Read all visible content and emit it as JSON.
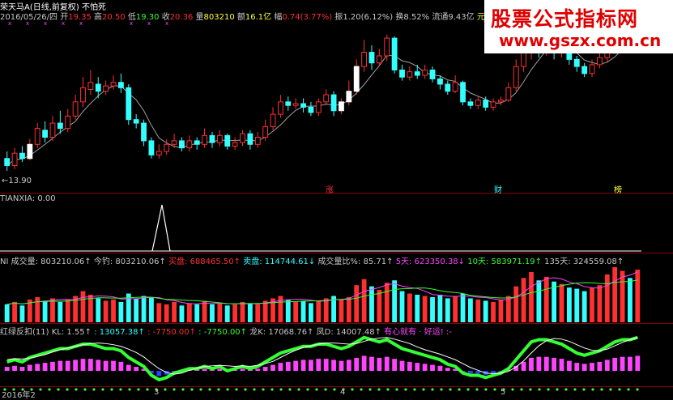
{
  "header": {
    "stock_title": "荣天马A(日线,前复权) 不怕死",
    "date": "2016/05/26/四",
    "open_label": "开",
    "open": "19.35",
    "high_label": "高",
    "high": "20.50",
    "low_label": "低",
    "low": "19.30",
    "close_label": "收",
    "close": "20.36",
    "volume_label": "量",
    "volume": "803210",
    "amount_label": "额",
    "amount": "16.1亿",
    "change_label": "幅",
    "change": "0.74(3.77%)",
    "amplitude_label": "振",
    "amplitude": "1.20(6.12%)",
    "turnover_label": "换",
    "turnover": "8.52%",
    "float_label": "流通",
    "float": "9.43亿",
    "component_label": "元器件"
  },
  "price_panel": {
    "low_marker": "←13.90",
    "events": [
      "涨",
      "财",
      "榜"
    ]
  },
  "tianxia_panel": {
    "label": "TIANXIA",
    "value": ": 0.00"
  },
  "volume_panel": {
    "prefix": "NI",
    "items": [
      {
        "text": "成交量: 803210.06↑",
        "color": "#c8c8c8"
      },
      {
        "text": "今钓: 803210.06↑",
        "color": "#c8c8c8"
      },
      {
        "text": "买盘: 688465.50↑",
        "color": "#ff3030"
      },
      {
        "text": "卖盘: 114744.61↓",
        "color": "#33ffff"
      },
      {
        "text": "成交量比%: 85.71↑",
        "color": "#c8c8c8"
      },
      {
        "text": "5天: 623350.38↓",
        "color": "#ff44ff"
      },
      {
        "text": "10天: 583971.19↑",
        "color": "#33ff33"
      },
      {
        "text": "135天: 324559.08↑",
        "color": "#c8c8c8"
      }
    ]
  },
  "indicator_panel": {
    "title": "红绿反扣(11)",
    "items": [
      {
        "text": "KL: 1.55↑",
        "color": "#c8c8c8"
      },
      {
        "text": ": 13057.38↑",
        "color": "#33ffff"
      },
      {
        "text": ": -7750.00↑",
        "color": "#ff3030"
      },
      {
        "text": ": -7750.00↑",
        "color": "#33ff33"
      },
      {
        "text": "龙K: 17068.76↑",
        "color": "#c8c8c8"
      },
      {
        "text": "凤D: 14007.48↑",
        "color": "#c8c8c8"
      },
      {
        "text": "有心就有 · 好运! :-",
        "color": "#ff44ff"
      }
    ]
  },
  "x_axis": {
    "labels": [
      "2016年2",
      "3",
      "4",
      "5"
    ]
  },
  "watermark": {
    "title": "股票公式指标网",
    "url": "www.gszx.com.cn"
  },
  "colors": {
    "up": "#ff3030",
    "down": "#33ffff",
    "grid": "#8a0000",
    "ma_white": "#e0e0e0",
    "ma_green": "#33ff33",
    "ma_magenta": "#ff44ff",
    "ind_pos": "#ff44ff",
    "ind_neg": "#2244ff"
  },
  "chart_data": {
    "type": "candlestick",
    "price_range": [
      13.4,
      22.0
    ],
    "candles": [
      [
        14.6,
        14.2,
        15.0,
        13.9
      ],
      [
        14.2,
        14.9,
        15.2,
        14.0
      ],
      [
        14.9,
        14.6,
        15.3,
        14.4
      ],
      [
        14.6,
        15.4,
        15.7,
        14.5
      ],
      [
        15.4,
        16.3,
        16.6,
        15.2
      ],
      [
        16.2,
        15.8,
        16.7,
        15.5
      ],
      [
        15.8,
        16.6,
        17.0,
        15.6
      ],
      [
        16.6,
        16.3,
        17.3,
        16.0
      ],
      [
        16.3,
        17.0,
        17.4,
        16.1
      ],
      [
        17.0,
        17.8,
        18.2,
        16.8
      ],
      [
        17.8,
        18.6,
        19.2,
        17.5
      ],
      [
        18.5,
        18.9,
        19.6,
        18.2
      ],
      [
        18.8,
        18.4,
        19.2,
        18.0
      ],
      [
        18.4,
        18.7,
        19.0,
        18.2
      ],
      [
        18.7,
        18.9,
        19.3,
        18.5
      ],
      [
        18.9,
        18.6,
        19.4,
        18.3
      ],
      [
        18.6,
        16.8,
        18.8,
        16.5
      ],
      [
        16.8,
        16.6,
        17.1,
        16.3
      ],
      [
        16.6,
        15.6,
        16.8,
        15.3
      ],
      [
        15.6,
        14.8,
        15.8,
        14.6
      ],
      [
        14.8,
        15.0,
        15.4,
        14.6
      ],
      [
        15.0,
        15.4,
        15.7,
        14.8
      ],
      [
        15.4,
        15.6,
        16.0,
        15.2
      ],
      [
        15.6,
        15.2,
        15.8,
        15.0
      ],
      [
        15.2,
        15.6,
        15.9,
        15.0
      ],
      [
        15.6,
        15.4,
        15.8,
        15.1
      ],
      [
        15.4,
        15.9,
        16.3,
        15.2
      ],
      [
        15.9,
        15.5,
        16.1,
        15.2
      ],
      [
        15.5,
        15.9,
        16.2,
        15.3
      ],
      [
        15.9,
        15.3,
        16.0,
        15.1
      ],
      [
        15.3,
        15.5,
        15.8,
        15.1
      ],
      [
        15.5,
        16.0,
        16.2,
        15.3
      ],
      [
        16.0,
        15.4,
        16.2,
        15.1
      ],
      [
        15.4,
        15.8,
        16.1,
        15.2
      ],
      [
        15.8,
        16.4,
        16.8,
        15.6
      ],
      [
        16.4,
        17.1,
        17.5,
        16.2
      ],
      [
        17.1,
        17.8,
        18.2,
        16.9
      ],
      [
        17.8,
        17.6,
        18.1,
        17.3
      ],
      [
        17.6,
        17.7,
        18.0,
        17.4
      ],
      [
        17.7,
        17.5,
        18.0,
        17.2
      ],
      [
        17.5,
        17.2,
        17.8,
        17.0
      ],
      [
        17.2,
        17.8,
        18.0,
        17.0
      ],
      [
        17.8,
        18.2,
        18.5,
        17.6
      ],
      [
        18.2,
        17.3,
        18.4,
        17.0
      ],
      [
        17.3,
        17.8,
        18.0,
        17.1
      ],
      [
        17.8,
        18.4,
        19.0,
        17.6
      ],
      [
        18.4,
        19.8,
        20.2,
        18.2
      ],
      [
        19.8,
        20.6,
        21.3,
        19.5
      ],
      [
        20.6,
        20.0,
        21.0,
        19.6
      ],
      [
        20.0,
        20.4,
        20.8,
        19.8
      ],
      [
        20.4,
        21.4,
        21.6,
        20.1
      ],
      [
        21.4,
        19.6,
        21.5,
        19.4
      ],
      [
        19.6,
        19.2,
        19.9,
        19.0
      ],
      [
        19.2,
        19.5,
        19.8,
        19.0
      ],
      [
        19.5,
        19.3,
        19.9,
        19.1
      ],
      [
        19.3,
        19.6,
        19.9,
        19.1
      ],
      [
        19.6,
        19.1,
        19.8,
        18.9
      ],
      [
        19.1,
        18.8,
        19.3,
        18.5
      ],
      [
        18.8,
        18.4,
        19.0,
        18.2
      ],
      [
        18.4,
        18.9,
        19.3,
        18.3
      ],
      [
        18.9,
        17.8,
        19.0,
        17.6
      ],
      [
        17.8,
        17.6,
        18.0,
        17.4
      ],
      [
        17.6,
        17.9,
        18.1,
        17.4
      ],
      [
        17.9,
        17.5,
        18.1,
        17.3
      ],
      [
        17.5,
        17.8,
        18.0,
        17.3
      ],
      [
        17.8,
        17.9,
        18.1,
        17.6
      ],
      [
        17.9,
        18.6,
        18.9,
        17.8
      ],
      [
        18.6,
        19.8,
        20.2,
        18.4
      ],
      [
        19.8,
        20.6,
        21.0,
        19.5
      ],
      [
        20.6,
        21.2,
        21.8,
        20.2
      ],
      [
        21.2,
        20.7,
        21.5,
        20.3
      ],
      [
        20.7,
        21.4,
        21.8,
        20.4
      ],
      [
        21.4,
        20.6,
        21.6,
        20.2
      ],
      [
        20.6,
        20.8,
        21.1,
        20.3
      ],
      [
        20.8,
        20.2,
        21.0,
        19.9
      ],
      [
        20.2,
        19.8,
        20.4,
        19.5
      ],
      [
        19.8,
        19.4,
        20.0,
        19.2
      ],
      [
        19.4,
        19.9,
        20.2,
        19.2
      ],
      [
        19.9,
        20.3,
        20.6,
        19.7
      ],
      [
        20.3,
        20.8,
        21.2,
        20.0
      ],
      [
        20.8,
        21.3,
        21.7,
        20.5
      ],
      [
        21.3,
        21.6,
        21.9,
        21.0
      ],
      [
        21.6,
        21.1,
        21.8,
        20.8
      ],
      [
        21.1,
        21.5,
        21.8,
        20.9
      ]
    ],
    "volume": [
      30,
      34,
      28,
      38,
      42,
      36,
      40,
      34,
      38,
      44,
      52,
      46,
      40,
      36,
      38,
      34,
      48,
      40,
      44,
      42,
      32,
      30,
      34,
      28,
      32,
      30,
      36,
      30,
      32,
      28,
      30,
      34,
      32,
      30,
      36,
      40,
      44,
      38,
      34,
      36,
      32,
      36,
      40,
      44,
      38,
      42,
      62,
      72,
      60,
      54,
      66,
      70,
      52,
      48,
      46,
      44,
      42,
      46,
      40,
      44,
      48,
      40,
      38,
      36,
      34,
      38,
      44,
      60,
      74,
      84,
      70,
      76,
      68,
      64,
      58,
      56,
      52,
      58,
      62,
      80,
      92,
      86,
      74,
      88
    ],
    "indicator": [
      4,
      5,
      4,
      6,
      7,
      8,
      9,
      10,
      10,
      11,
      12,
      12,
      11,
      10,
      10,
      9,
      6,
      4,
      2,
      -2,
      -4,
      -3,
      -1,
      0,
      1,
      1,
      2,
      1,
      2,
      0,
      1,
      2,
      1,
      2,
      4,
      6,
      8,
      9,
      10,
      11,
      11,
      12,
      12,
      11,
      10,
      11,
      13,
      15,
      14,
      13,
      14,
      12,
      10,
      9,
      8,
      7,
      6,
      5,
      3,
      2,
      -1,
      -2,
      -2,
      -3,
      -2,
      -1,
      1,
      5,
      9,
      13,
      14,
      14,
      13,
      12,
      10,
      8,
      7,
      8,
      9,
      11,
      13,
      14,
      14,
      15
    ]
  }
}
